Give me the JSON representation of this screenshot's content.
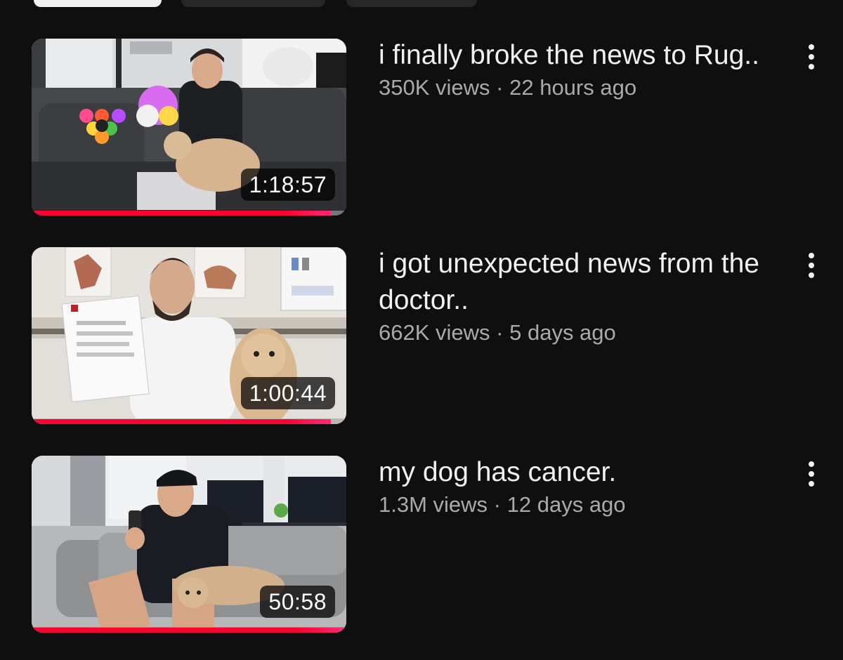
{
  "filter_chips": [
    {
      "label": "",
      "active": true
    },
    {
      "label": "",
      "active": false
    },
    {
      "label": "",
      "active": false
    }
  ],
  "videos": [
    {
      "title": "i finally broke the news to Rug..",
      "views": "350K views",
      "separator": "·",
      "age": "22 hours ago",
      "duration": "1:18:57",
      "watched_fraction": 0.95
    },
    {
      "title": "i got unexpected news from the doctor..",
      "views": "662K views",
      "separator": "·",
      "age": "5 days ago",
      "duration": "1:00:44",
      "watched_fraction": 0.95
    },
    {
      "title": "my dog has cancer.",
      "views": "1.3M views",
      "separator": "·",
      "age": "12 days ago",
      "duration": "50:58",
      "watched_fraction": 1.0
    }
  ],
  "icons": {
    "more_actions": "more-vert-icon"
  },
  "colors": {
    "background": "#0f0f0f",
    "title_text": "#f1f1f1",
    "subtitle_text": "#aaaaaa",
    "progress": "#ff0033"
  }
}
